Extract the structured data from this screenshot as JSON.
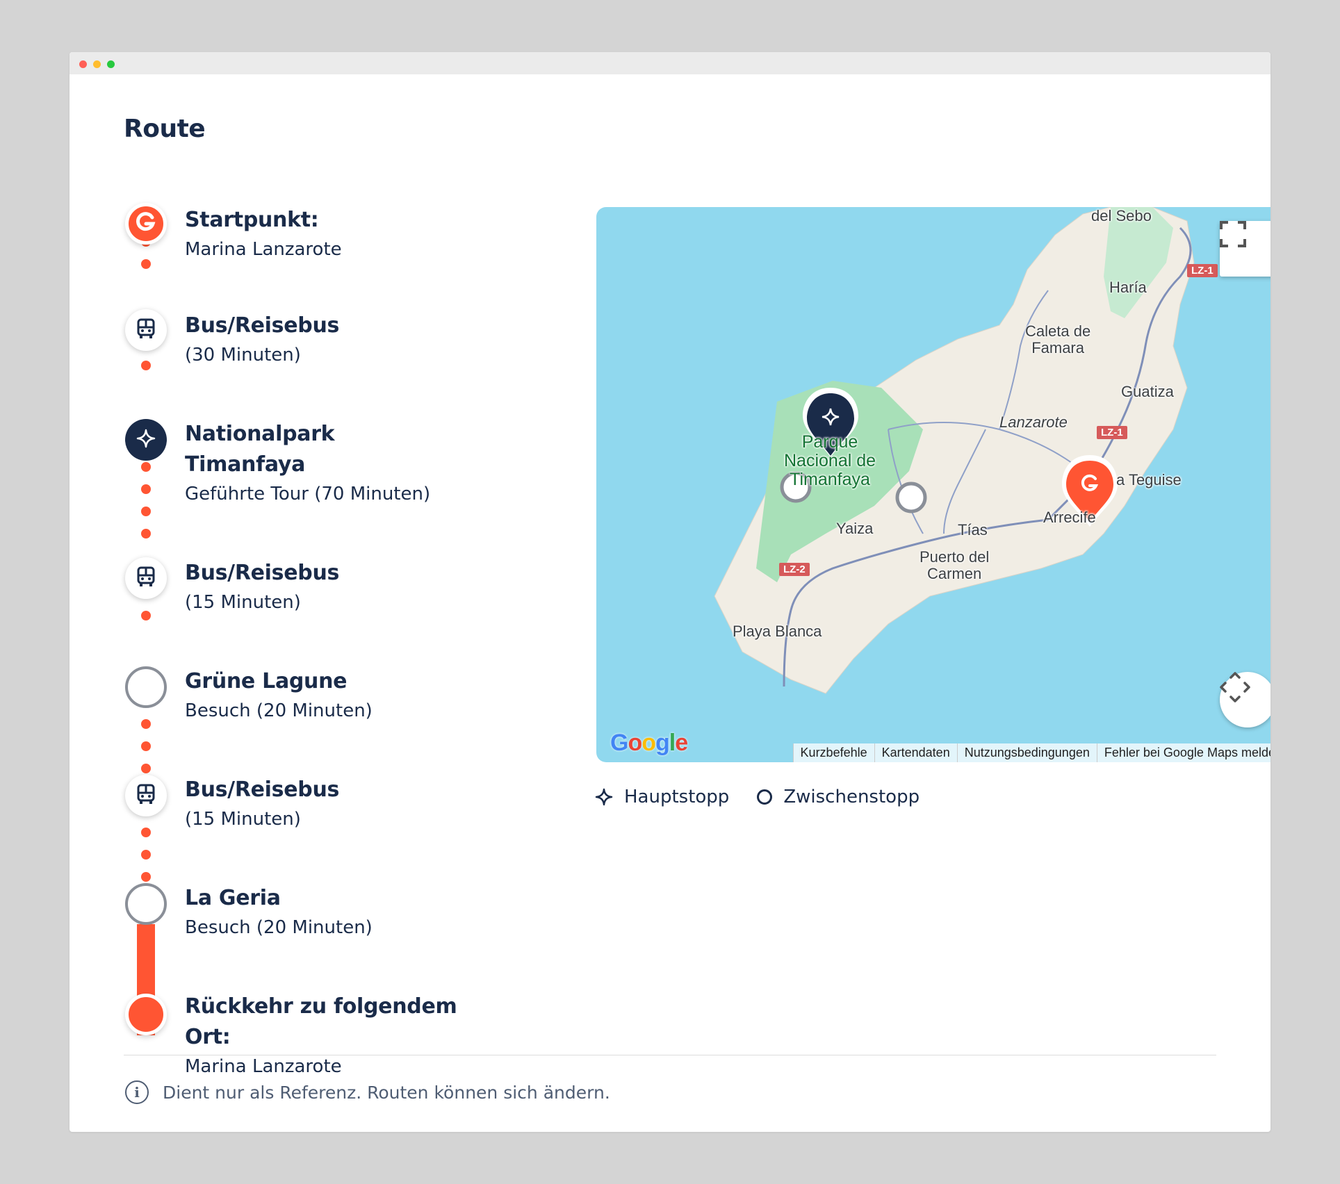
{
  "route": {
    "title": "Route",
    "steps": [
      {
        "kind": "start",
        "icon": "getyourguide-logo-icon",
        "title": "Startpunkt:",
        "subtitle": "Marina Lanzarote"
      },
      {
        "kind": "transport",
        "icon": "bus-icon",
        "title": "Bus/Reisebus",
        "subtitle": "(30 Minuten)"
      },
      {
        "kind": "main",
        "icon": "sparkle-icon",
        "title_line1": "Nationalpark",
        "title_line2": "Timanfaya",
        "subtitle": "Geführte Tour (70 Minuten)"
      },
      {
        "kind": "transport",
        "icon": "bus-icon",
        "title": "Bus/Reisebus",
        "subtitle": "(15 Minuten)"
      },
      {
        "kind": "stop",
        "icon": "circle-stop-icon",
        "title": "Grüne Lagune",
        "subtitle": "Besuch (20 Minuten)"
      },
      {
        "kind": "transport",
        "icon": "bus-icon",
        "title": "Bus/Reisebus",
        "subtitle": "(15 Minuten)"
      },
      {
        "kind": "stop",
        "icon": "circle-stop-icon",
        "title": "La Geria",
        "subtitle": "Besuch (20 Minuten)"
      },
      {
        "kind": "end",
        "icon": "end-dot-icon",
        "title_line1": "Rückkehr zu folgendem",
        "title_line2": "Ort:",
        "subtitle": "Marina Lanzarote"
      }
    ]
  },
  "map": {
    "places": {
      "caleta_sebo": "del Sebo",
      "haria": "Haría",
      "caleta_famara": "Caleta de\nFamara",
      "guatiza": "Guatiza",
      "lanzarote": "Lanzarote",
      "park": "Parque\nNacional de\nTimanfaya",
      "teguise": "a Teguise",
      "arrecife": "Arrecife",
      "yaiza": "Yaiza",
      "tias": "Tías",
      "puerto_carmen": "Puerto del\nCarmen",
      "playa_blanca": "Playa Blanca"
    },
    "roads": {
      "lz1_north": "LZ-1",
      "lz1_mid": "LZ-1",
      "lz2": "LZ-2"
    },
    "google_logo": "Google",
    "attribution": [
      "Kurzbefehle",
      "Kartendaten",
      "Nutzungsbedingungen",
      "Fehler bei Google Maps melden"
    ],
    "fullscreen_icon": "fullscreen-icon",
    "recenter_icon": "recenter-icon"
  },
  "legend": {
    "main": "Hauptstopp",
    "intermediate": "Zwischenstopp"
  },
  "footnote": "Dient nur als Referenz. Routen können sich ändern.",
  "colors": {
    "accent": "#ff5533",
    "navy": "#1a2b49",
    "sea": "#90d8ee",
    "land": "#f1ede4",
    "park": "#a8e0b8"
  }
}
